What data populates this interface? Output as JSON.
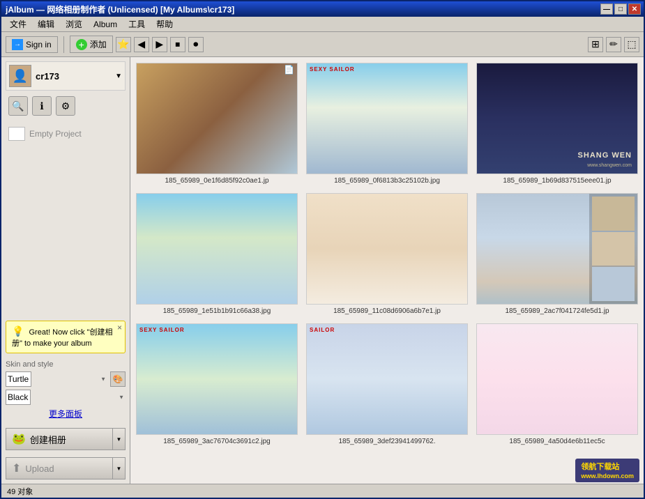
{
  "window": {
    "title": "jAlbum — 网络相册制作者 (Unlicensed) [My Albums\\cr173]",
    "minimize_label": "—",
    "maximize_label": "□",
    "close_label": "✕"
  },
  "menu": {
    "items": [
      "文件",
      "编辑",
      "浏览",
      "Album",
      "工具",
      "帮助"
    ]
  },
  "toolbar": {
    "sign_in_label": "Sign in",
    "add_label": "添加",
    "icons": [
      "⭐",
      "◀",
      "▶",
      "⏹",
      "⏺"
    ]
  },
  "sidebar": {
    "username": "cr173",
    "search_icon": "🔍",
    "info_icon": "ℹ",
    "settings_icon": "⚙",
    "empty_project_label": "Empty Project",
    "tooltip": {
      "text": "Great! Now click \"创建相册\" to make your album",
      "close": "×"
    },
    "skin_section_label": "Skin and style",
    "skin_select_value": "Turtle",
    "color_select_value": "Black",
    "more_panels_label": "更多面板",
    "create_album_label": "创建相册",
    "upload_label": "Upload"
  },
  "photos": [
    {
      "filename": "185_65989_0e1f6d85f92c0ae1.jp",
      "bg": "#c8a060",
      "overlay": "",
      "has_corner_icon": true
    },
    {
      "filename": "185_65989_0f6813b3c25102b.jpg",
      "bg": "#87ceeb",
      "overlay": "SEXY SAILOR",
      "has_corner_icon": false
    },
    {
      "filename": "185_65989_1b69d837515eee01.jp",
      "bg": "#1a1a2e",
      "overlay": "SHANG WEN",
      "has_corner_icon": false
    },
    {
      "filename": "185_65989_1e51b1b91c66a38.jpg",
      "bg": "#87ceeb",
      "overlay": "",
      "has_corner_icon": false
    },
    {
      "filename": "185_65989_11c08d6906a6b7e1.jp",
      "bg": "#f0e8d8",
      "overlay": "",
      "has_corner_icon": false
    },
    {
      "filename": "185_65989_2ac7f041724fe5d1.jp",
      "bg": "#d4c8b8",
      "overlay": "",
      "has_corner_icon": false
    },
    {
      "filename": "185_65989_3ac76704c3691c2.jpg",
      "bg": "#87ceeb",
      "overlay": "SEXY SAILOR",
      "has_corner_icon": false
    },
    {
      "filename": "185_65989_3def23941499762.",
      "bg": "#c8d4e8",
      "overlay": "SAILOR",
      "has_corner_icon": false
    },
    {
      "filename": "185_65989_4a50d4e6b11ec5c",
      "bg": "#f8e8f0",
      "overlay": "",
      "has_corner_icon": false
    }
  ],
  "status": {
    "count_label": "49 对象"
  },
  "colors": {
    "title_bar_start": "#1e4fd4",
    "title_bar_end": "#0a246a",
    "sidebar_bg": "#e8e4de",
    "grid_bg": "#f0ece8"
  }
}
